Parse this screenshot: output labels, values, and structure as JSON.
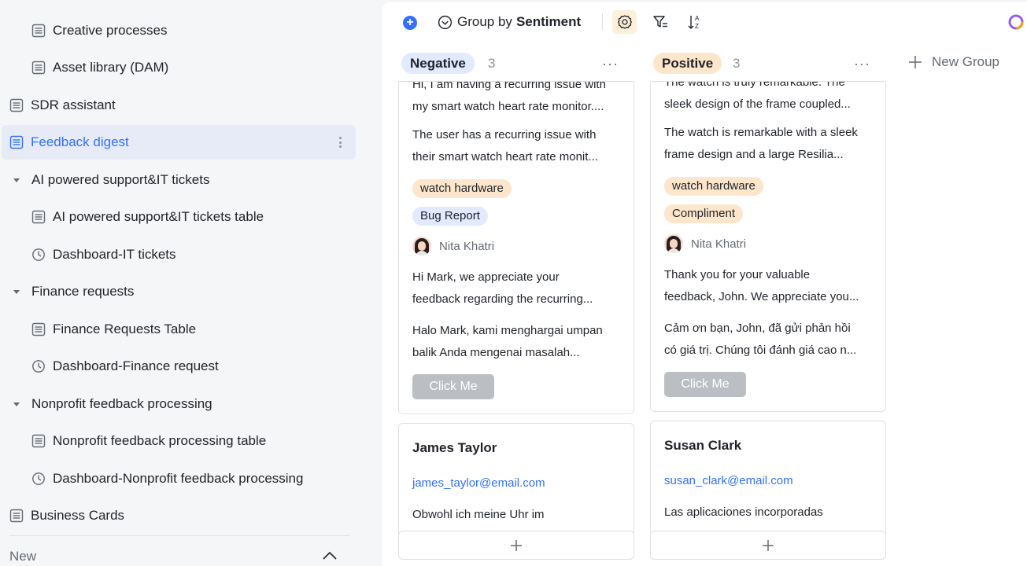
{
  "sidebar": {
    "items": [
      {
        "label": "Creative processes",
        "icon": "table-icon"
      },
      {
        "label": "Asset library (DAM)",
        "icon": "table-icon"
      },
      {
        "label": "SDR assistant",
        "icon": "table-icon"
      },
      {
        "label": "Feedback digest",
        "icon": "table-icon",
        "active": true
      },
      {
        "label": "AI powered support&IT tickets",
        "icon": "caret-down-icon"
      },
      {
        "label": "AI powered support&IT tickets table",
        "icon": "table-icon"
      },
      {
        "label": "Dashboard-IT tickets",
        "icon": "dashboard-icon"
      },
      {
        "label": "Finance requests",
        "icon": "caret-down-icon"
      },
      {
        "label": "Finance Requests Table",
        "icon": "table-icon"
      },
      {
        "label": "Dashboard-Finance request",
        "icon": "dashboard-icon"
      },
      {
        "label": "Nonprofit feedback processing",
        "icon": "caret-down-icon"
      },
      {
        "label": "Nonprofit feedback processing table",
        "icon": "table-icon"
      },
      {
        "label": "Dashboard-Nonprofit feedback processing",
        "icon": "dashboard-icon"
      },
      {
        "label": "Business Cards",
        "icon": "table-icon"
      }
    ],
    "new_label": "New"
  },
  "toolbar": {
    "group_by_prefix": "Group by",
    "group_by_field": "Sentiment"
  },
  "columns": [
    {
      "name": "Negative",
      "count": "3",
      "card1": {
        "line1": "Hi, I am having a recurring issue with",
        "line2": "my smart watch heart rate monitor....",
        "line3": "The user has a recurring issue with",
        "line4": "their smart watch heart rate monit...",
        "tag1": "watch hardware",
        "tag2": "Bug Report",
        "person": "Nita Khatri",
        "line5": "Hi Mark, we appreciate your",
        "line6": "feedback regarding the recurring...",
        "line7": "Halo Mark, kami menghargai umpan",
        "line8": "balik Anda mengenai masalah...",
        "button": "Click Me"
      },
      "card2": {
        "name": "James Taylor",
        "email": "james_taylor@email.com",
        "text": "Obwohl ich meine Uhr im"
      }
    },
    {
      "name": "Positive",
      "count": "3",
      "card1": {
        "line1": "The watch is truly remarkable. The",
        "line2": "sleek design of the frame coupled...",
        "line3": "The watch is remarkable with a sleek",
        "line4": "frame design and a large Resilia...",
        "tag1": "watch hardware",
        "tag2": "Compliment",
        "person": "Nita Khatri",
        "line5": "Thank you for your valuable",
        "line6": "feedback, John. We appreciate you...",
        "line7": "Cảm ơn bạn, John, đã gửi phản hồi",
        "line8": "có giá trị. Chúng tôi đánh giá cao n...",
        "button": "Click Me"
      },
      "card2": {
        "name": "Susan Clark",
        "email": "susan_clark@email.com",
        "text": "Las aplicaciones incorporadas"
      }
    }
  ],
  "new_group_label": "New Group",
  "colors": {
    "accent": "#3370ff",
    "negative_pill": "#e1eaff",
    "positive_pill": "#fde6cc",
    "settings_bg": "#fcf0d8"
  }
}
